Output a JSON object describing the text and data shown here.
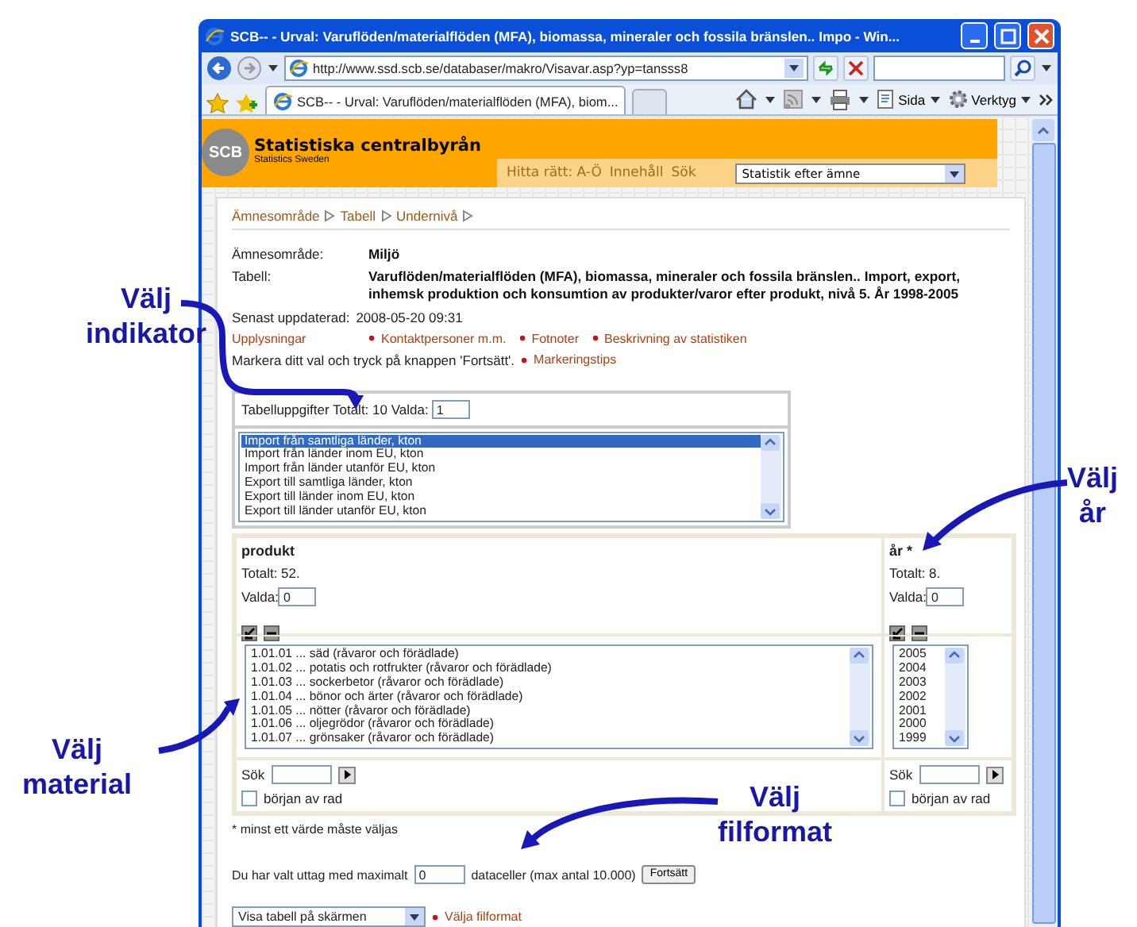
{
  "window": {
    "title": "SCB-- - Urval: Varuflöden/materialflöden (MFA), biomassa, mineraler och fossila bränslen.. Impo - Win..."
  },
  "address_bar": {
    "url": "http://www.ssd.scb.se/databaser/makro/Visavar.asp?yp=tansss8"
  },
  "tab": {
    "title": "SCB-- - Urval: Varuflöden/materialflöden (MFA), biom..."
  },
  "toolbar": {
    "page_menu": "Sida",
    "tools_menu": "Verktyg"
  },
  "site_header": {
    "logo": "SCB",
    "name": "Statistiska centralbyrån",
    "subtitle": "Statistics Sweden",
    "links": [
      "Hitta rätt: A-Ö",
      "Innehåll",
      "Sök"
    ],
    "select": "Statistik efter ämne"
  },
  "breadcrumb": [
    "Ämnesområde",
    "Tabell",
    "Undernivå"
  ],
  "info": [
    {
      "label": "Ämnesområde:",
      "value": "Miljö"
    },
    {
      "label": "Tabell:",
      "value": "Varuflöden/materialflöden (MFA), biomassa, mineraler och fossila bränslen.. Import, export, inhemsk produktion och konsumtion av produkter/varor efter produkt, nivå 5. År 1998-2005"
    }
  ],
  "updated": {
    "label": "Senast uppdaterad:",
    "value": "2008-05-20 09:31"
  },
  "upplysningar": {
    "label": "Upplysningar",
    "links": [
      "Kontaktpersoner m.m.",
      "Fotnoter",
      "Beskrivning av statistiken"
    ]
  },
  "instruction": {
    "text": "Markera ditt val och tryck på knappen 'Fortsätt'.",
    "link": "Markeringstips"
  },
  "indicator": {
    "label": "Tabelluppgifter Totalt: 10 Valda:",
    "count": "1",
    "options": [
      {
        "text": "Import från samtliga länder, kton",
        "selected": true
      },
      {
        "text": "Import från länder inom EU, kton",
        "selected": false
      },
      {
        "text": "Import från länder utanför EU, kton",
        "selected": false
      },
      {
        "text": "Export till samtliga länder, kton",
        "selected": false
      },
      {
        "text": "Export till länder inom EU, kton",
        "selected": false
      },
      {
        "text": "Export till länder utanför EU, kton",
        "selected": false
      }
    ]
  },
  "variables": [
    {
      "name": "produkt",
      "total": "Totalt: 52.",
      "valda_label": "Valda:",
      "valda": "0",
      "search_label": "Sök",
      "checkbox_label": "början av rad",
      "checked": false,
      "options": [
        {
          "text": "1.01.01 ... säd (råvaror och förädlade)",
          "selected": false
        },
        {
          "text": "1.01.02 ... potatis och rotfrukter (råvaror och förädlade)",
          "selected": false
        },
        {
          "text": "1.01.03 ... sockerbetor (råvaror och förädlade)",
          "selected": false
        },
        {
          "text": "1.01.04 ... bönor och ärter (råvaror och förädlade)",
          "selected": false
        },
        {
          "text": "1.01.05 ... nötter (råvaror och förädlade)",
          "selected": false
        },
        {
          "text": "1.01.06 ... oljegrödor (råvaror och förädlade)",
          "selected": false
        },
        {
          "text": "1.01.07 ... grönsaker (råvaror och förädlade)",
          "selected": false
        }
      ]
    },
    {
      "name": "år *",
      "total": "Totalt: 8.",
      "valda_label": "Valda:",
      "valda": "0",
      "search_label": "Sök",
      "checkbox_label": "början av rad",
      "checked": false,
      "options": [
        {
          "text": "2005",
          "selected": false
        },
        {
          "text": "2004",
          "selected": false
        },
        {
          "text": "2003",
          "selected": false
        },
        {
          "text": "2002",
          "selected": false
        },
        {
          "text": "2001",
          "selected": false
        },
        {
          "text": "2000",
          "selected": false
        },
        {
          "text": "1999",
          "selected": false
        }
      ]
    }
  ],
  "required_note": "* minst ett värde måste väljas",
  "extract": {
    "before": "Du har valt uttag med maximalt",
    "value": "0",
    "after": "dataceller (max antal 10.000)",
    "button": "Fortsätt"
  },
  "format": {
    "select": "Visa tabell på skärmen",
    "link": "Välja filformat"
  },
  "annotations": [
    {
      "lines": [
        "Välj",
        "indikator"
      ]
    },
    {
      "lines": [
        "Välj",
        "material"
      ]
    },
    {
      "lines": [
        "Välj",
        "år"
      ]
    },
    {
      "lines": [
        "Välj",
        "filformat"
      ]
    }
  ]
}
